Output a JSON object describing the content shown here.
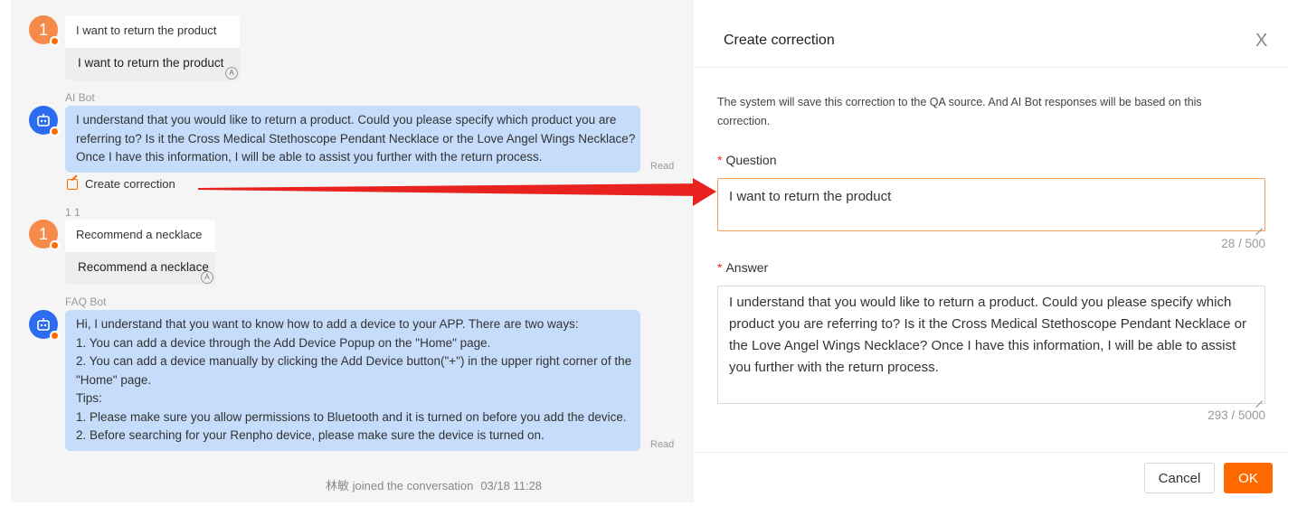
{
  "chat": {
    "msg1": {
      "avatar": "1",
      "text": "I want to return the product",
      "suggestion": "I want to return the product"
    },
    "bot1": {
      "name": "AI Bot",
      "lines": [
        "I understand that you would like to return a product. Could you please specify which product you are",
        "referring to? Is it the Cross Medical Stethoscope Pendant Necklace or the Love Angel Wings Necklace?",
        "Once I have this information, I will be able to assist you further with the return process."
      ],
      "status": "Read"
    },
    "correction_link": "Create correction",
    "small_text": "1 1",
    "msg2": {
      "avatar": "1",
      "text": "Recommend a necklace",
      "suggestion": "Recommend a necklace"
    },
    "bot2": {
      "name": "FAQ Bot",
      "lines": [
        "Hi, I understand that you want to know how to add a device to your APP. There are two ways:",
        "1. You can add a device through the Add Device Popup on the \"Home\" page.",
        "2. You can add a device manually by clicking the Add Device button(\"+\") in the upper right corner of the",
        "\"Home\" page.",
        "Tips:",
        "1. Please make sure you allow permissions to Bluetooth and it is turned on before you add the device.",
        "2. Before searching for your Renpho device, please make sure the device is turned on."
      ],
      "status": "Read"
    },
    "joined": {
      "text": "林敏 joined the conversation",
      "time": "03/18 11:28"
    },
    "annotation_color": "#e8231f"
  },
  "panel": {
    "title": "Create correction",
    "close": "X",
    "description": "The system will save this correction to the QA source. And AI Bot responses will be based on this correction.",
    "question": {
      "required": "*",
      "label": "Question",
      "value": "I want to return the product",
      "count": "28 / 500"
    },
    "answer": {
      "required": "*",
      "label": "Answer",
      "value": "I understand that you would like to return a product. Could you please specify which product you are referring to? Is it the Cross Medical Stethoscope Pendant Necklace or the Love Angel Wings Necklace? Once I have this information, I will be able to assist you further with the return process.",
      "count": "293 / 5000"
    },
    "cancel": "Cancel",
    "ok": "OK",
    "accent": "#ff6a00"
  }
}
